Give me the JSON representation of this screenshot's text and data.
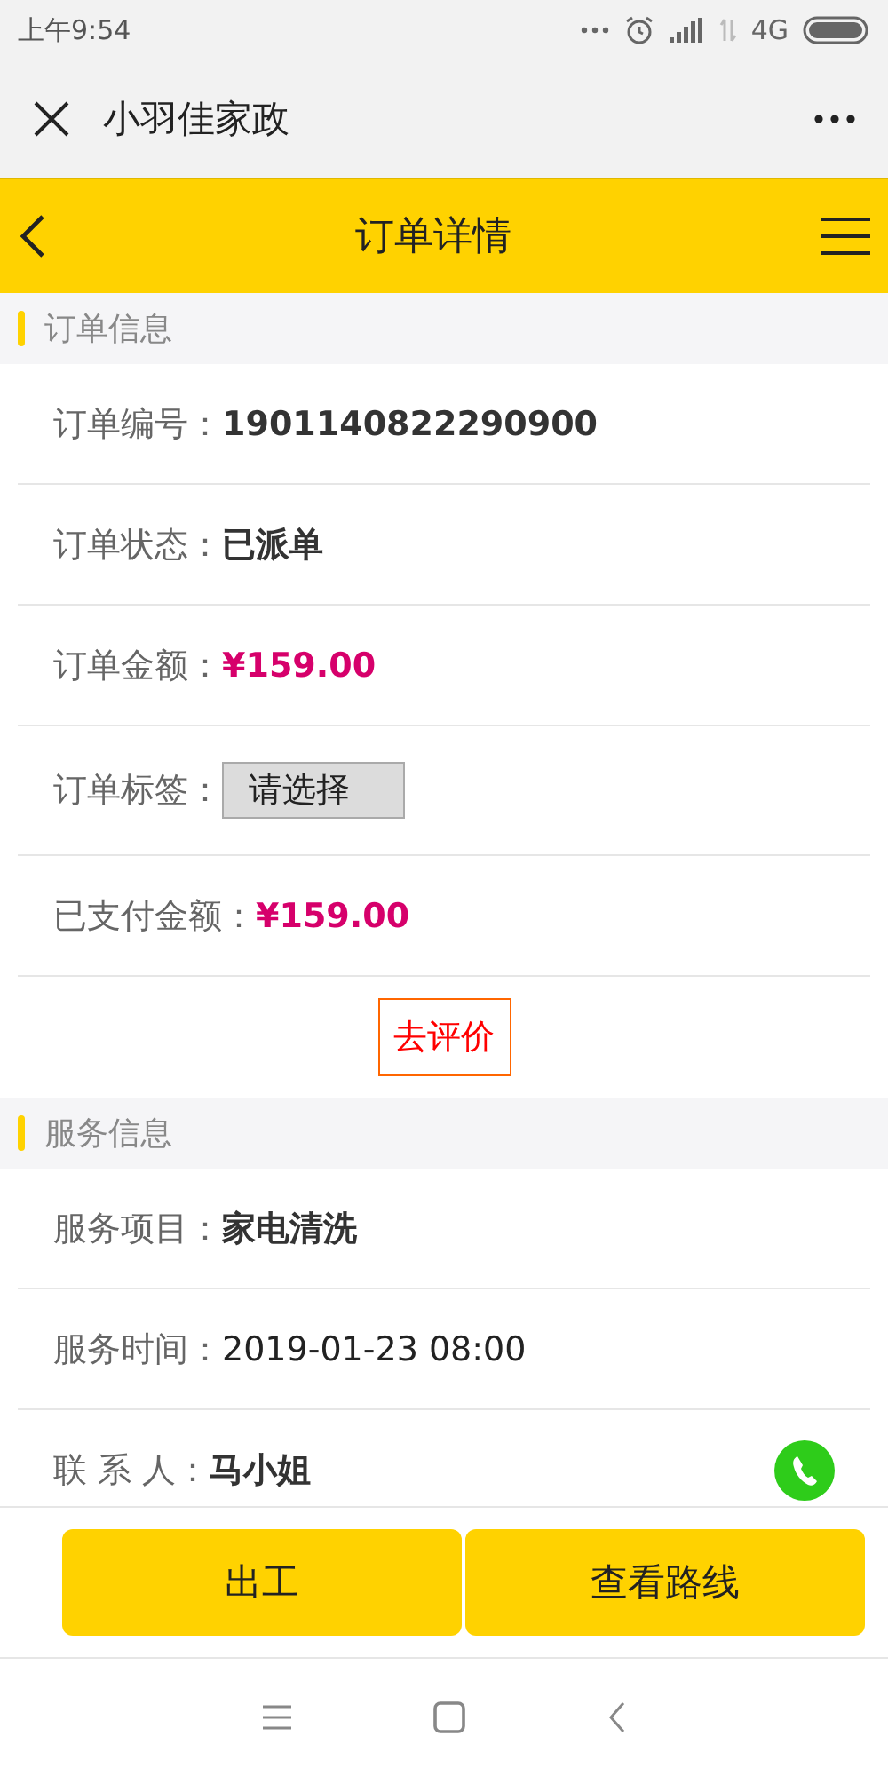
{
  "status_bar": {
    "time": "上午9:54",
    "network": "4G"
  },
  "app_bar": {
    "title": "小羽佳家政"
  },
  "header": {
    "title": "订单详情"
  },
  "sections": [
    {
      "title": "订单信息",
      "rows": [
        {
          "kind": "text",
          "label": "订单编号：",
          "value": "1901140822290900"
        },
        {
          "kind": "text",
          "label": "订单状态：",
          "value": "已派单"
        },
        {
          "kind": "price",
          "label": "订单金额：",
          "value": "¥159.00"
        },
        {
          "kind": "select",
          "label": "订单标签：",
          "placeholder": "请选择"
        },
        {
          "kind": "price",
          "label": "已支付金额：",
          "value": "¥159.00"
        }
      ],
      "action": "去评价"
    },
    {
      "title": "服务信息",
      "rows": [
        {
          "kind": "text",
          "label": "服务项目：",
          "value": "家电清洗"
        },
        {
          "kind": "plain",
          "label": "服务时间：",
          "value": "2019-01-23 08:00"
        },
        {
          "kind": "phone",
          "label": "联 系 人：",
          "value": "马小姐"
        }
      ]
    }
  ],
  "buttons": [
    "出工",
    "查看路线"
  ]
}
